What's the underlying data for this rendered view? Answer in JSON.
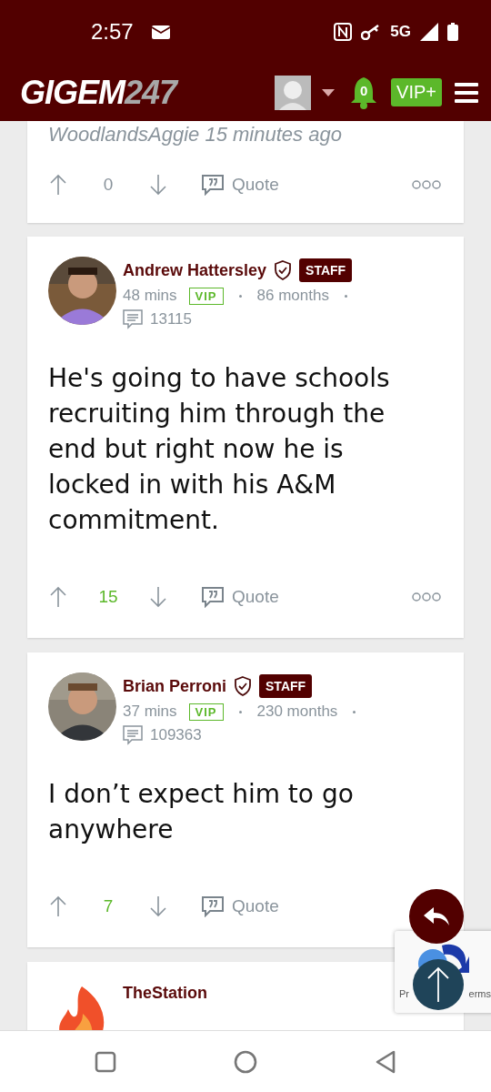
{
  "status_bar": {
    "time": "2:57",
    "network": "5G"
  },
  "header": {
    "logo_main": "GIGEM",
    "logo_sub": "247",
    "notifications": "0",
    "vip_button": "VIP+"
  },
  "posts": [
    {
      "kind": "partial",
      "byline": "WoodlandsAggie 15 minutes ago",
      "score": "0",
      "score_positive": false,
      "quote": "Quote"
    },
    {
      "kind": "full",
      "author": "Andrew Hattersley",
      "badge": "STAFF",
      "time": "48 mins",
      "tier": "VIP",
      "tenure": "86 months",
      "post_count": "13115",
      "body": "He's going to have schools recruiting him through the end but right now he is locked in with his A&M commitment.",
      "score": "15",
      "score_positive": true,
      "quote": "Quote",
      "menu": true
    },
    {
      "kind": "full",
      "author": "Brian Perroni",
      "badge": "STAFF",
      "time": "37 mins",
      "tier": "VIP",
      "tenure": "230 months",
      "post_count": "109363",
      "body": "I don’t expect him to go anywhere",
      "score": "7",
      "score_positive": true,
      "quote": "Quote",
      "menu": false
    },
    {
      "kind": "cut",
      "avatar": {
        "kind": "flame"
      },
      "author": "TheStation"
    }
  ],
  "recaptcha": {
    "left_text": "Pr",
    "right_text": "erms"
  }
}
